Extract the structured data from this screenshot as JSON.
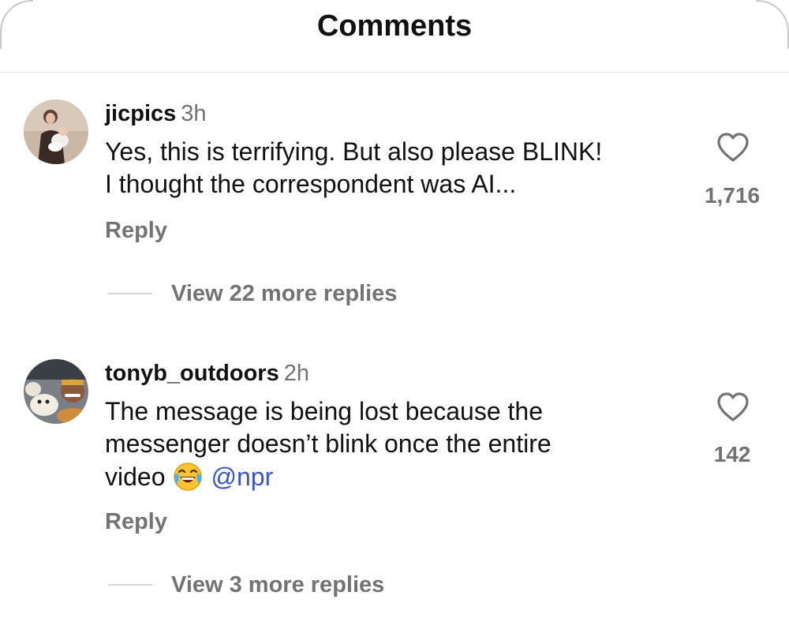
{
  "header": {
    "title": "Comments"
  },
  "comments": [
    {
      "username": "jicpics",
      "time": "3h",
      "text_lines": [
        "Yes, this is terrifying. But also please BLINK!",
        "I thought the correspondent was AI..."
      ],
      "likes": "1,716",
      "reply_label": "Reply",
      "view_replies_label": "View 22 more replies",
      "icon": "heart-icon"
    },
    {
      "username": "tonyb_outdoors",
      "time": "2h",
      "text_lines": [
        "The message is being lost because the",
        "messenger doesn’t blink once the entire",
        "video"
      ],
      "emoji": "face-with-tears-of-joy",
      "mention": "@npr",
      "likes": "142",
      "reply_label": "Reply",
      "view_replies_label": "View 3 more replies",
      "icon": "heart-icon"
    }
  ],
  "colors": {
    "primary_text": "#111111",
    "secondary_text": "#737373",
    "mention": "#3b55c9",
    "divider": "#e5e5e5"
  }
}
